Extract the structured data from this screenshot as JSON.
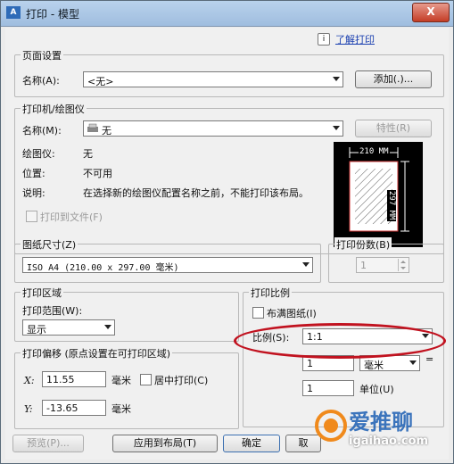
{
  "window": {
    "title": "打印 - 模型",
    "app_icon": "A",
    "close_label": "X"
  },
  "help": {
    "icon": "i",
    "link": "了解打印"
  },
  "page_setup": {
    "legend": "页面设置",
    "name_label": "名称(A):",
    "name_value": "<无>",
    "add_button": "添加(.)..."
  },
  "printer": {
    "legend": "打印机/绘图仪",
    "name_label": "名称(M):",
    "name_value": "无",
    "properties_button": "特性(R)",
    "plotter_label": "绘图仪:",
    "plotter_value": "无",
    "location_label": "位置:",
    "location_value": "不可用",
    "description_label": "说明:",
    "description_value": "在选择新的绘图仪配置名称之前，不能打印该布局。",
    "print_to_file": "打印到文件(F)",
    "preview_width": "210 MM",
    "preview_height": "297 MM"
  },
  "paper_size": {
    "legend": "图纸尺寸(Z)",
    "value": "ISO A4 (210.00 x 297.00 毫米)"
  },
  "copies": {
    "legend": "打印份数(B)",
    "value": "1"
  },
  "plot_area": {
    "legend": "打印区域",
    "range_label": "打印范围(W):",
    "range_value": "显示"
  },
  "plot_scale": {
    "legend": "打印比例",
    "fit_paper": "布满图纸(I)",
    "scale_label": "比例(S):",
    "scale_value": "1:1",
    "value1": "1",
    "unit_value": "毫米",
    "equals": "=",
    "value2": "1",
    "unit_label": "单位(U)"
  },
  "plot_offset": {
    "legend": "打印偏移 (原点设置在可打印区域)",
    "x_label": "X:",
    "x_value": "11.55",
    "x_unit": "毫米",
    "center_print": "居中打印(C)",
    "y_label": "Y:",
    "y_value": "-13.65",
    "y_unit": "毫米"
  },
  "buttons": {
    "preview": "预览(P)...",
    "apply_layout": "应用到布局(T)",
    "ok": "确定",
    "cancel": "取"
  },
  "watermark": {
    "text": "爱推聊",
    "url": "igaihao.com"
  },
  "colors": {
    "accent_red": "#c1121f",
    "link_blue": "#1a3fb0"
  }
}
